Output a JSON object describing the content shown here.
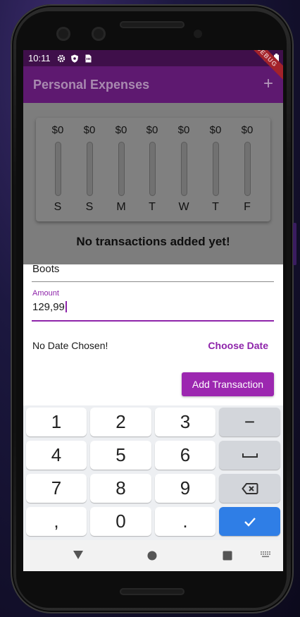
{
  "status_bar": {
    "time": "10:11",
    "icons": [
      "gear-icon",
      "shield-icon",
      "sim-card-icon",
      "wifi-icon",
      "battery-icon"
    ]
  },
  "app_bar": {
    "title": "Personal Expenses",
    "add_icon": "+",
    "debug_banner": "DEBUG",
    "color": "#5e1970"
  },
  "chart": {
    "bars": [
      {
        "amount": "$0",
        "day": "S",
        "fraction": 0
      },
      {
        "amount": "$0",
        "day": "S",
        "fraction": 0
      },
      {
        "amount": "$0",
        "day": "M",
        "fraction": 0
      },
      {
        "amount": "$0",
        "day": "T",
        "fraction": 0
      },
      {
        "amount": "$0",
        "day": "W",
        "fraction": 0
      },
      {
        "amount": "$0",
        "day": "T",
        "fraction": 0
      },
      {
        "amount": "$0",
        "day": "F",
        "fraction": 0
      }
    ]
  },
  "empty_message": "No transactions added yet!",
  "form": {
    "title_value": "Boots",
    "amount_label": "Amount",
    "amount_value": "129,99",
    "date_text": "No Date Chosen!",
    "choose_date_label": "Choose Date",
    "submit_label": "Add Transaction",
    "accent_color": "#9c27b0"
  },
  "keyboard": {
    "keys": [
      {
        "label": "1",
        "type": "digit"
      },
      {
        "label": "2",
        "type": "digit"
      },
      {
        "label": "3",
        "type": "digit"
      },
      {
        "label": "−",
        "type": "fn"
      },
      {
        "label": "4",
        "type": "digit"
      },
      {
        "label": "5",
        "type": "digit"
      },
      {
        "label": "6",
        "type": "digit"
      },
      {
        "label": "␣",
        "type": "fn"
      },
      {
        "label": "7",
        "type": "digit"
      },
      {
        "label": "8",
        "type": "digit"
      },
      {
        "label": "9",
        "type": "digit"
      },
      {
        "label": "backspace-icon",
        "type": "fn"
      },
      {
        "label": ",",
        "type": "digit"
      },
      {
        "label": "0",
        "type": "digit"
      },
      {
        "label": ".",
        "type": "digit"
      },
      {
        "label": "check-icon",
        "type": "go"
      }
    ]
  },
  "nav_bar": {
    "icons": [
      "back-triangle-icon",
      "home-circle-icon",
      "recents-square-icon",
      "keyboard-switch-icon"
    ]
  }
}
